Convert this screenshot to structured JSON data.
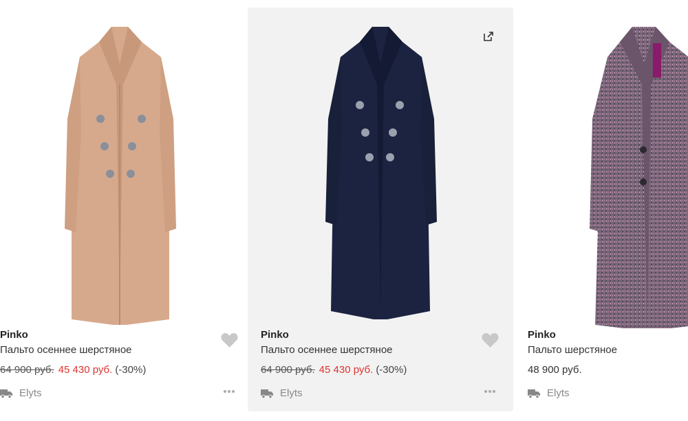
{
  "products": [
    {
      "brand": "Pinko",
      "title": "Пальто осеннее шерстяное",
      "old_price": "64 900 руб.",
      "new_price": "45 430 руб.",
      "discount": "(-30%)",
      "seller": "Elyts",
      "coat_color": "#d7a98c",
      "icons": [
        "heart-icon",
        "truck-icon",
        "more-icon"
      ]
    },
    {
      "brand": "Pinko",
      "title": "Пальто осеннее шерстяное",
      "old_price": "64 900 руб.",
      "new_price": "45 430 руб.",
      "discount": "(-30%)",
      "seller": "Elyts",
      "coat_color": "#1c2341",
      "icons": [
        "external-link-icon",
        "heart-icon",
        "truck-icon",
        "more-icon"
      ]
    },
    {
      "brand": "Pinko",
      "title": "Пальто шерстяное",
      "price": "48 900 руб.",
      "seller": "Elyts",
      "coat_color": "#7a6478",
      "icons": [
        "truck-icon",
        "more-icon"
      ]
    }
  ],
  "colors": {
    "sale_price": "#e0342f",
    "hover_bg": "#f2f2f2",
    "icon_gray": "#c8c8c8"
  }
}
